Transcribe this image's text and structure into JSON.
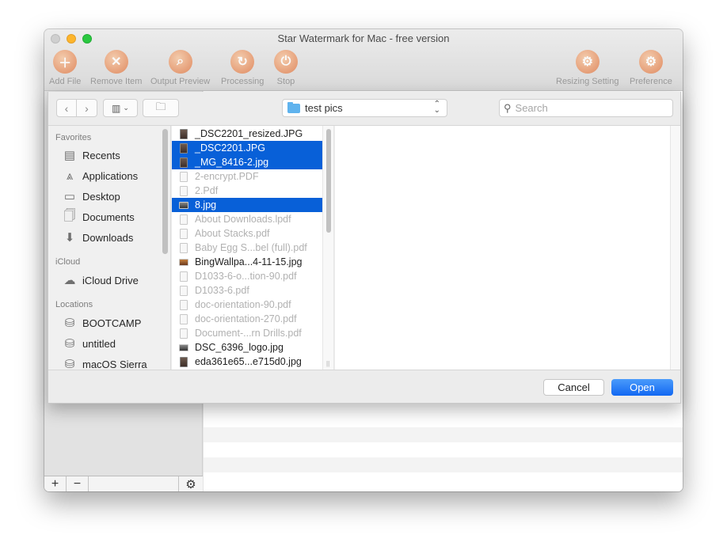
{
  "window": {
    "title": "Star Watermark for Mac - free version"
  },
  "toolbar": {
    "items": [
      {
        "label": "Add File",
        "icon": "add-file-icon"
      },
      {
        "label": "Remove Item",
        "icon": "remove-icon"
      },
      {
        "label": "Output Preview",
        "icon": "preview-icon"
      },
      {
        "label": "Processing",
        "icon": "processing-icon"
      },
      {
        "label": "Stop",
        "icon": "stop-icon"
      },
      {
        "label": "Resizing Setting",
        "icon": "user-gear-icon"
      },
      {
        "label": "Preference",
        "icon": "user-gear-icon"
      }
    ]
  },
  "dialog": {
    "location": "test pics",
    "search_placeholder": "Search",
    "search_value": "",
    "sidebar": {
      "sections": [
        {
          "heading": "Favorites",
          "items": [
            {
              "label": "Recents",
              "icon": "recents-icon"
            },
            {
              "label": "Applications",
              "icon": "applications-icon"
            },
            {
              "label": "Desktop",
              "icon": "desktop-icon"
            },
            {
              "label": "Documents",
              "icon": "documents-icon"
            },
            {
              "label": "Downloads",
              "icon": "downloads-icon"
            }
          ]
        },
        {
          "heading": "iCloud",
          "items": [
            {
              "label": "iCloud Drive",
              "icon": "cloud-icon"
            }
          ]
        },
        {
          "heading": "Locations",
          "items": [
            {
              "label": "BOOTCAMP",
              "icon": "disk-icon"
            },
            {
              "label": "untitled",
              "icon": "disk-icon"
            },
            {
              "label": "macOS Sierra",
              "icon": "disk-icon"
            }
          ]
        }
      ]
    },
    "files": [
      {
        "name": "_DSC2201_resized.JPG",
        "state": "normal",
        "kind": "image"
      },
      {
        "name": "_DSC2201.JPG",
        "state": "selected",
        "kind": "image"
      },
      {
        "name": "_MG_8416-2.jpg",
        "state": "selected",
        "kind": "image"
      },
      {
        "name": "2-encrypt.PDF",
        "state": "dim",
        "kind": "pdf"
      },
      {
        "name": "2.Pdf",
        "state": "dim",
        "kind": "pdf"
      },
      {
        "name": "8.jpg",
        "state": "selected",
        "kind": "landscape"
      },
      {
        "name": "About Downloads.lpdf",
        "state": "dim",
        "kind": "pdf"
      },
      {
        "name": "About Stacks.pdf",
        "state": "dim",
        "kind": "pdf"
      },
      {
        "name": "Baby Egg S...bel (full).pdf",
        "state": "dim",
        "kind": "pdf"
      },
      {
        "name": "BingWallpa...4-11-15.jpg",
        "state": "normal",
        "kind": "bing"
      },
      {
        "name": "D1033-6-o...tion-90.pdf",
        "state": "dim",
        "kind": "pdf"
      },
      {
        "name": "D1033-6.pdf",
        "state": "dim",
        "kind": "pdf"
      },
      {
        "name": "doc-orientation-90.pdf",
        "state": "dim",
        "kind": "pdf"
      },
      {
        "name": "doc-orientation-270.pdf",
        "state": "dim",
        "kind": "pdf"
      },
      {
        "name": "Document-...rn Drills.pdf",
        "state": "dim",
        "kind": "pdf"
      },
      {
        "name": "DSC_6396_logo.jpg",
        "state": "normal",
        "kind": "landscape"
      },
      {
        "name": "eda361e65...e715d0.jpg",
        "state": "normal",
        "kind": "image"
      }
    ],
    "cancel_label": "Cancel",
    "open_label": "Open"
  },
  "bottom_bar": {
    "add_label": "+",
    "remove_label": "−",
    "gear_label": "⚙"
  }
}
